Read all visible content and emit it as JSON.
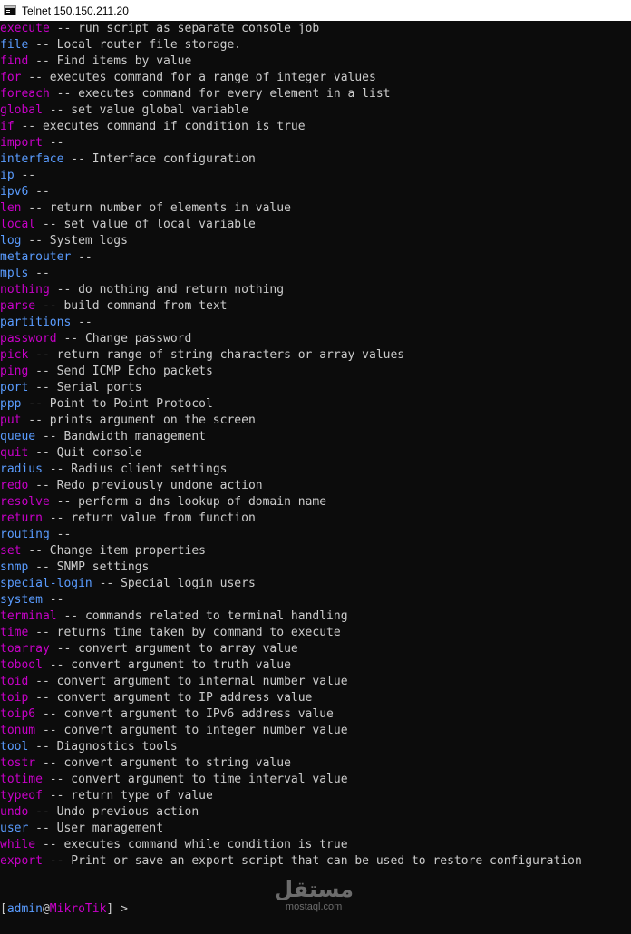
{
  "window": {
    "title": "Telnet 150.150.211.20",
    "icon": "console-icon"
  },
  "colors": {
    "background": "#0c0c0c",
    "text": "#cccccc",
    "command": "#c800c8",
    "menu": "#5a9cff"
  },
  "lines": [
    {
      "cmd": "execute",
      "desc": "run script as separate console job",
      "kind": "command"
    },
    {
      "cmd": "file",
      "desc": "Local router file storage.",
      "kind": "menu"
    },
    {
      "cmd": "find",
      "desc": "Find items by value",
      "kind": "command"
    },
    {
      "cmd": "for",
      "desc": "executes command for a range of integer values",
      "kind": "command"
    },
    {
      "cmd": "foreach",
      "desc": "executes command for every element in a list",
      "kind": "command"
    },
    {
      "cmd": "global",
      "desc": "set value global variable",
      "kind": "command"
    },
    {
      "cmd": "if",
      "desc": "executes command if condition is true",
      "kind": "command"
    },
    {
      "cmd": "import",
      "desc": "",
      "kind": "command"
    },
    {
      "cmd": "interface",
      "desc": "Interface configuration",
      "kind": "menu"
    },
    {
      "cmd": "ip",
      "desc": "",
      "kind": "menu"
    },
    {
      "cmd": "ipv6",
      "desc": "",
      "kind": "menu"
    },
    {
      "cmd": "len",
      "desc": "return number of elements in value",
      "kind": "command"
    },
    {
      "cmd": "local",
      "desc": "set value of local variable",
      "kind": "command"
    },
    {
      "cmd": "log",
      "desc": "System logs",
      "kind": "menu"
    },
    {
      "cmd": "metarouter",
      "desc": "",
      "kind": "menu"
    },
    {
      "cmd": "mpls",
      "desc": "",
      "kind": "menu"
    },
    {
      "cmd": "nothing",
      "desc": "do nothing and return nothing",
      "kind": "command"
    },
    {
      "cmd": "parse",
      "desc": "build command from text",
      "kind": "command"
    },
    {
      "cmd": "partitions",
      "desc": "",
      "kind": "menu"
    },
    {
      "cmd": "password",
      "desc": "Change password",
      "kind": "command"
    },
    {
      "cmd": "pick",
      "desc": "return range of string characters or array values",
      "kind": "command"
    },
    {
      "cmd": "ping",
      "desc": "Send ICMP Echo packets",
      "kind": "command"
    },
    {
      "cmd": "port",
      "desc": "Serial ports",
      "kind": "menu"
    },
    {
      "cmd": "ppp",
      "desc": "Point to Point Protocol",
      "kind": "menu"
    },
    {
      "cmd": "put",
      "desc": "prints argument on the screen",
      "kind": "command"
    },
    {
      "cmd": "queue",
      "desc": "Bandwidth management",
      "kind": "menu"
    },
    {
      "cmd": "quit",
      "desc": "Quit console",
      "kind": "command"
    },
    {
      "cmd": "radius",
      "desc": "Radius client settings",
      "kind": "menu"
    },
    {
      "cmd": "redo",
      "desc": "Redo previously undone action",
      "kind": "command"
    },
    {
      "cmd": "resolve",
      "desc": "perform a dns lookup of domain name",
      "kind": "command"
    },
    {
      "cmd": "return",
      "desc": "return value from function",
      "kind": "command"
    },
    {
      "cmd": "routing",
      "desc": "",
      "kind": "menu"
    },
    {
      "cmd": "set",
      "desc": "Change item properties",
      "kind": "command"
    },
    {
      "cmd": "snmp",
      "desc": "SNMP settings",
      "kind": "menu"
    },
    {
      "cmd": "special-login",
      "desc": "Special login users",
      "kind": "menu"
    },
    {
      "cmd": "system",
      "desc": "",
      "kind": "menu"
    },
    {
      "cmd": "terminal",
      "desc": "commands related to terminal handling",
      "kind": "command"
    },
    {
      "cmd": "time",
      "desc": "returns time taken by command to execute",
      "kind": "command"
    },
    {
      "cmd": "toarray",
      "desc": "convert argument to array value",
      "kind": "command"
    },
    {
      "cmd": "tobool",
      "desc": "convert argument to truth value",
      "kind": "command"
    },
    {
      "cmd": "toid",
      "desc": "convert argument to internal number value",
      "kind": "command"
    },
    {
      "cmd": "toip",
      "desc": "convert argument to IP address value",
      "kind": "command"
    },
    {
      "cmd": "toip6",
      "desc": "convert argument to IPv6 address value",
      "kind": "command"
    },
    {
      "cmd": "tonum",
      "desc": "convert argument to integer number value",
      "kind": "command"
    },
    {
      "cmd": "tool",
      "desc": "Diagnostics tools",
      "kind": "menu"
    },
    {
      "cmd": "tostr",
      "desc": "convert argument to string value",
      "kind": "command"
    },
    {
      "cmd": "totime",
      "desc": "convert argument to time interval value",
      "kind": "command"
    },
    {
      "cmd": "typeof",
      "desc": "return type of value",
      "kind": "command"
    },
    {
      "cmd": "undo",
      "desc": "Undo previous action",
      "kind": "command"
    },
    {
      "cmd": "user",
      "desc": "User management",
      "kind": "menu"
    },
    {
      "cmd": "while",
      "desc": "executes command while condition is true",
      "kind": "command"
    },
    {
      "cmd": "export",
      "desc": "Print or save an export script that can be used to restore configuration",
      "kind": "command"
    }
  ],
  "separator": " -- ",
  "prompt": {
    "open": "[",
    "user": "admin",
    "at": "@",
    "host": "MikroTik",
    "close": "] >"
  },
  "watermark": {
    "arabic": "مستقل",
    "latin": "mostaql.com"
  }
}
